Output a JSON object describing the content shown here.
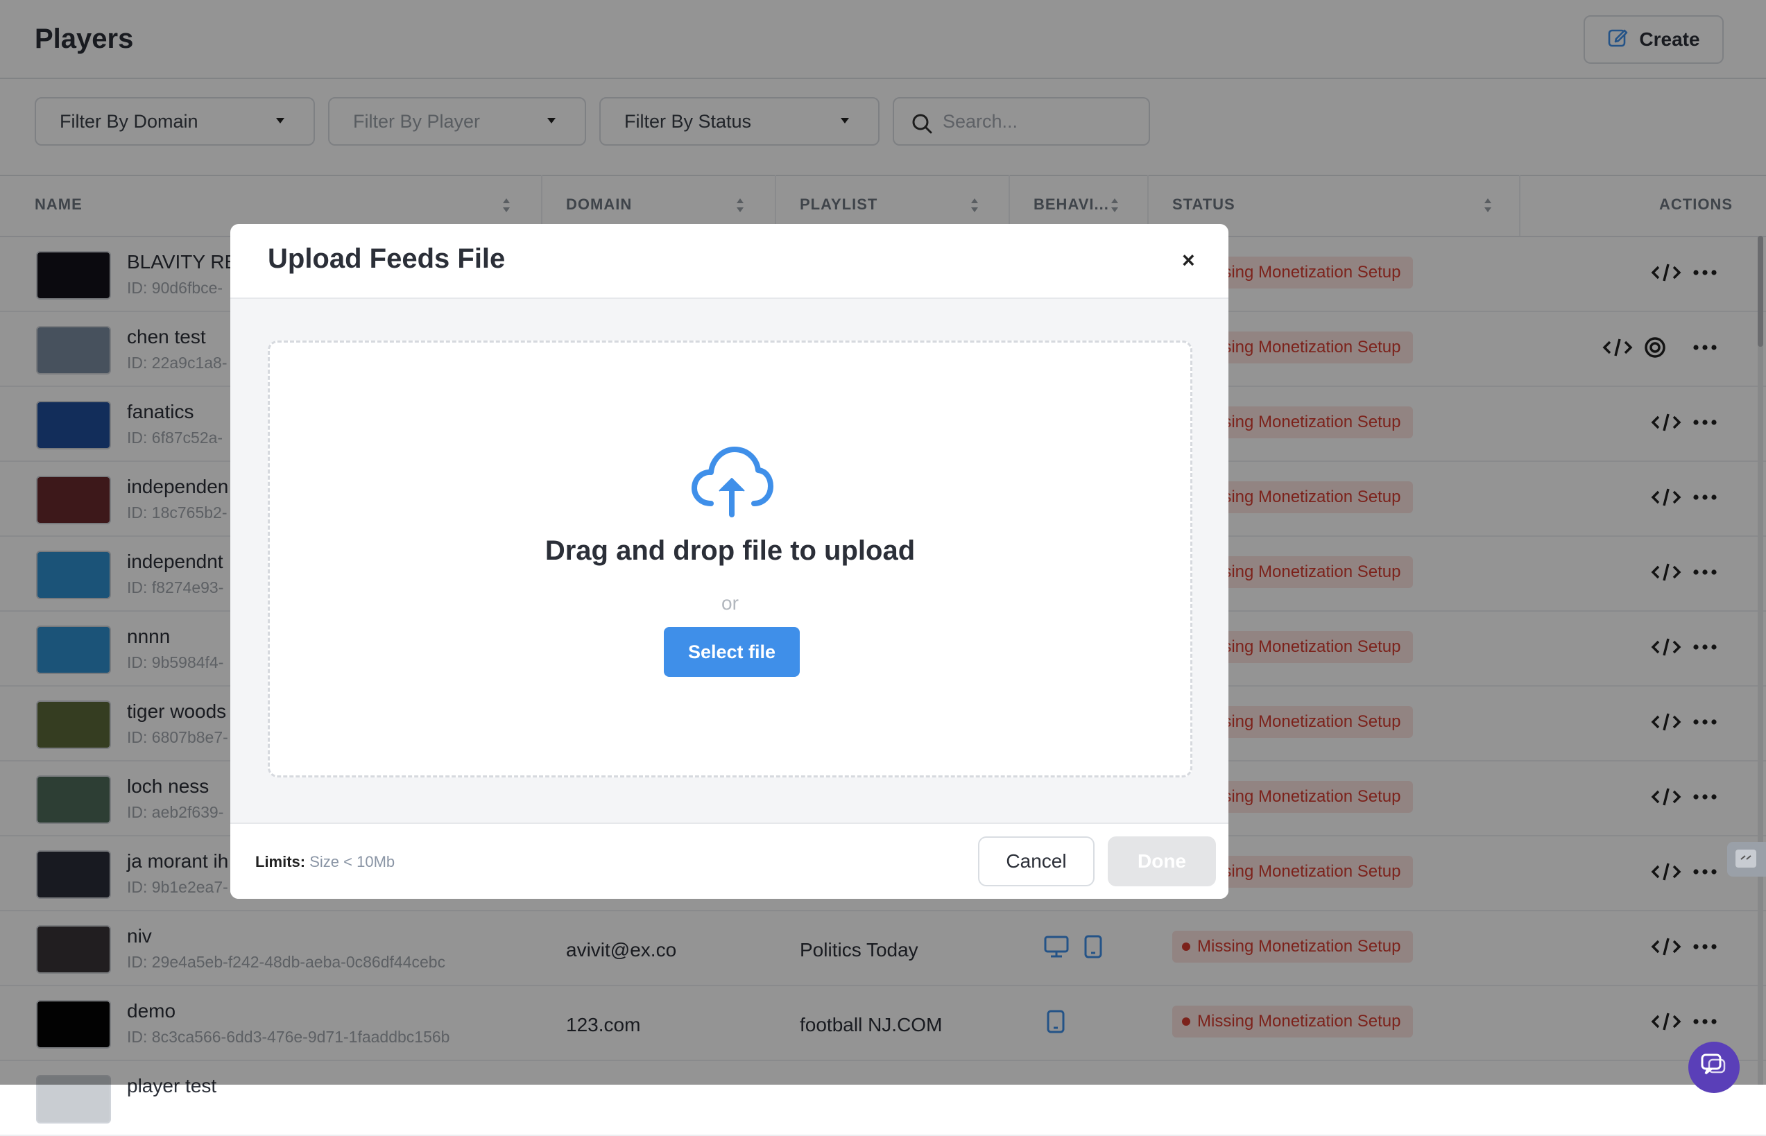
{
  "header": {
    "title": "Players",
    "create_label": "Create"
  },
  "filters": {
    "domain": "Filter By Domain",
    "player": "Filter By Player",
    "status": "Filter By Status",
    "search_placeholder": "Search..."
  },
  "table": {
    "columns": {
      "name": "NAME",
      "domain": "DOMAIN",
      "playlist": "PLAYLIST",
      "behavior": "BEHAVI...",
      "status": "STATUS",
      "actions": "ACTIONS"
    },
    "rows": [
      {
        "name": "BLAVITY REG",
        "id": "ID: 90d6fbce-",
        "status": "Missing Monetization Setup"
      },
      {
        "name": "chen test",
        "id": "ID: 22a9c1a8-",
        "status": "Missing Monetization Setup"
      },
      {
        "name": "fanatics",
        "id": "ID: 6f87c52a-",
        "status": "Missing Monetization Setup"
      },
      {
        "name": "independen",
        "id": "ID: 18c765b2-",
        "status": "Missing Monetization Setup"
      },
      {
        "name": "independnt",
        "id": "ID: f8274e93-",
        "status": "Missing Monetization Setup"
      },
      {
        "name": "nnnn",
        "id": "ID: 9b5984f4-",
        "status": "Missing Monetization Setup"
      },
      {
        "name": "tiger woods",
        "id": "ID: 6807b8e7-",
        "status": "Missing Monetization Setup"
      },
      {
        "name": "loch ness",
        "id": "ID: aeb2f639-",
        "status": "Missing Monetization Setup"
      },
      {
        "name": "ja morant ih",
        "id": "ID: 9b1e2ea7-",
        "status": "Missing Monetization Setup"
      },
      {
        "name": "niv",
        "id": "ID: 29e4a5eb-f242-48db-aeba-0c86df44cebc",
        "domain": "avivit@ex.co",
        "playlist": "Politics Today",
        "status": "Missing Monetization Setup"
      },
      {
        "name": "demo",
        "id": "ID: 8c3ca566-6dd3-476e-9d71-1faaddbc156b",
        "domain": "123.com",
        "playlist": "football NJ.COM",
        "status": "Missing Monetization Setup"
      },
      {
        "name": "player test",
        "id": "",
        "status": ""
      }
    ]
  },
  "modal": {
    "title": "Upload Feeds File",
    "close": "×",
    "drop_text": "Drag and drop file to upload",
    "or_text": "or",
    "select_label": "Select file",
    "limits_label": "Limits:",
    "limits_value": "Size < 10Mb",
    "cancel_label": "Cancel",
    "done_label": "Done"
  },
  "colors": {
    "accent": "#3f8fe9",
    "status_bg": "#fbe3e1",
    "status_text": "#d63c30"
  }
}
